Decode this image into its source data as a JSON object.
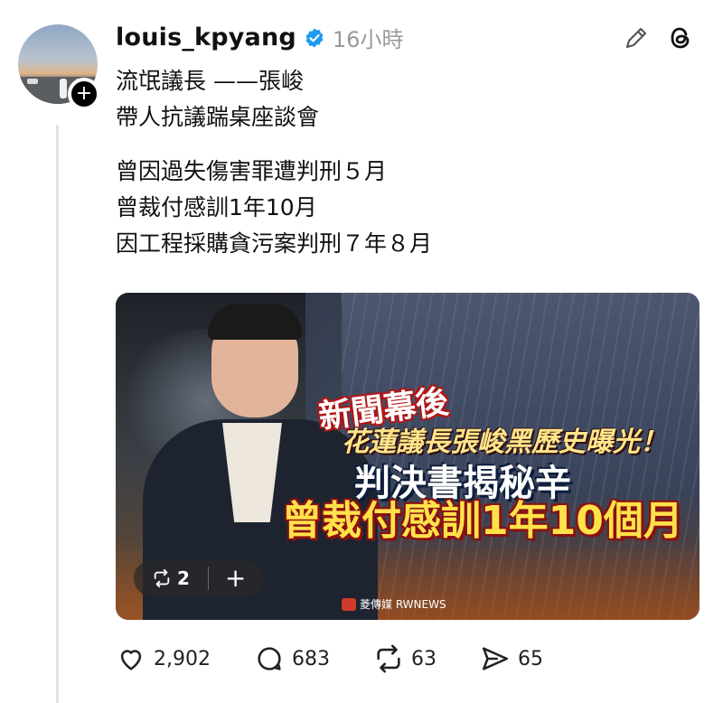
{
  "post": {
    "username": "louis_kpyang",
    "time": "16小時",
    "text_lines": [
      "流氓議長 ——張峻",
      "帶人抗議踹桌座談會",
      "",
      "曾因過失傷害罪遭判刑５月",
      "曾裁付感訓1年10月",
      "因工程採購貪污案判刑７年８月"
    ]
  },
  "media": {
    "headline_1": "新聞幕後",
    "headline_2": "花蓮議長張峻黑歷史曝光！",
    "headline_3": "判決書揭秘辛",
    "headline_4": "曾裁付感訓1年10個月",
    "watermark": "菱傳媒 RWNEWS",
    "repost_count": "2"
  },
  "stats": {
    "likes": "2,902",
    "replies": "683",
    "reposts": "63",
    "shares": "65"
  },
  "colors": {
    "verified": "#1d9bf0",
    "headline_yellow": "#ffe24a",
    "headline_red": "#b01616"
  },
  "icons": [
    "plus-icon",
    "verified-badge-icon",
    "edit-pencil-icon",
    "threads-logo-icon",
    "repost-icon",
    "heart-icon",
    "comment-icon",
    "repost-icon",
    "share-icon"
  ]
}
